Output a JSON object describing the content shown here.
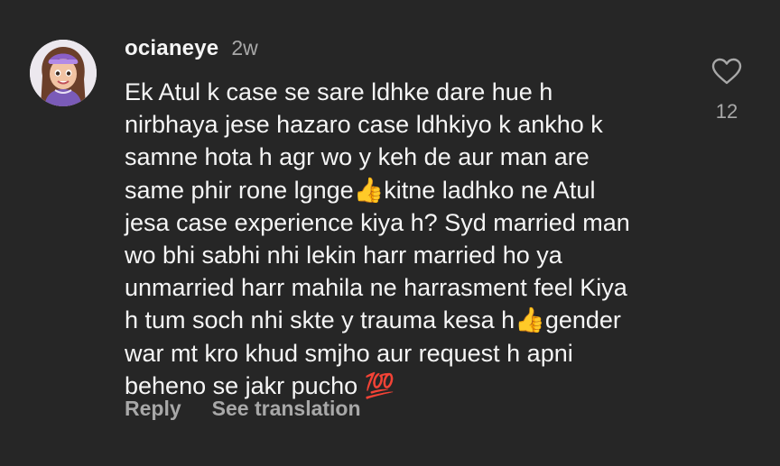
{
  "comment": {
    "username": "ocianeye",
    "time": "2w",
    "text": "Ek Atul k case se sare ldhke dare hue h\nnirbhaya jese hazaro case ldhkiyo k ankho k\nsamne hota h agr wo y keh de aur man are\nsame phir rone lgnge👍kitne ladhko ne Atul\njesa case experience kiya h? Syd married man\nwo bhi sabhi nhi lekin harr married ho ya\nunmarried harr mahila ne harrasment feel Kiya\nh tum soch nhi skte y trauma kesa h👍gender\nwar mt kro khud smjho aur request h apni\nbeheno se jakr pucho 💯",
    "like_count": "12"
  },
  "actions": {
    "reply_label": "Reply",
    "translation_label": "See translation"
  },
  "icons": {
    "like": "heart-outline-icon"
  },
  "colors": {
    "background": "#262626",
    "primary_text": "#f5f5f5",
    "secondary_text": "#a8a8a8"
  }
}
